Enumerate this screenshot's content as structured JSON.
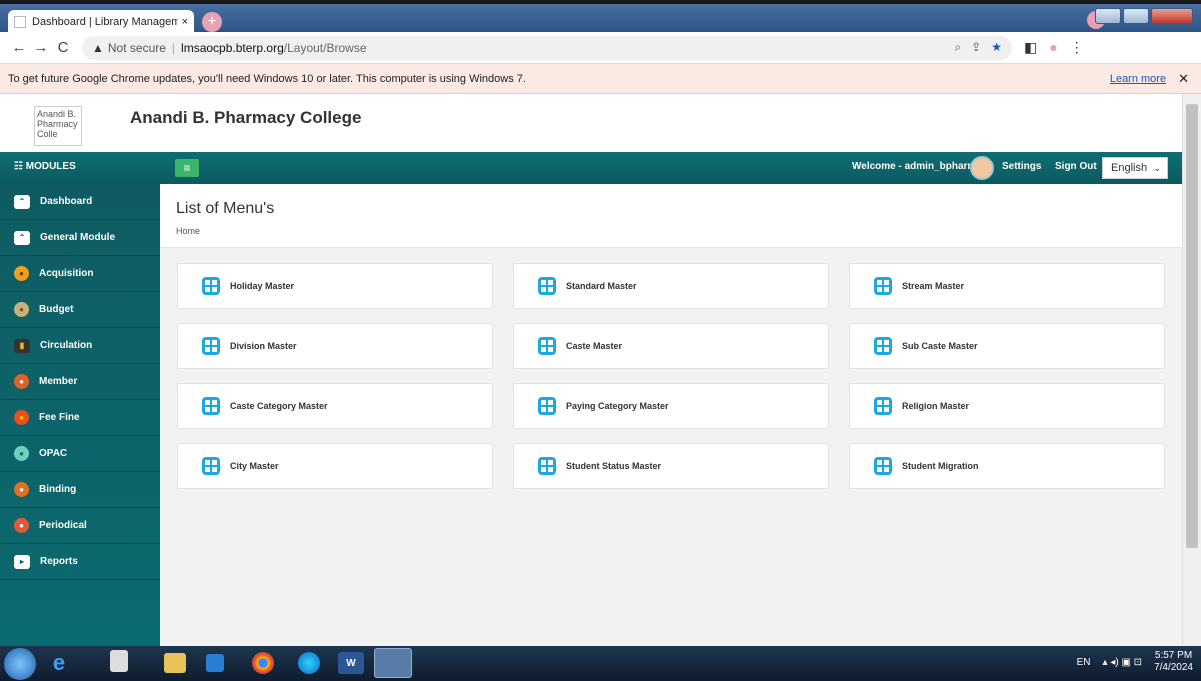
{
  "browser": {
    "tab_title": "Dashboard | Library Managemen",
    "tab_close": "×",
    "new_tab": "+",
    "back": "←",
    "forward": "→",
    "reload": "C",
    "security_warning": "▲",
    "security_text": "Not secure",
    "separator": "|",
    "url_domain": "lmsaocpb.bterp.org",
    "url_path": "/Layout/Browse",
    "zoom_icon": "⌕",
    "share_icon": "⇪",
    "bookmark_icon": "★",
    "sidepanel_icon": "◧",
    "profile_icon": "●",
    "menu_icon": "⋮"
  },
  "infobar": {
    "message": "To get future Google Chrome updates, you'll need Windows 10 or later. This computer is using Windows 7.",
    "learn_more": "Learn more",
    "close": "✕"
  },
  "header": {
    "logo_alt": "Anandi B. Pharmacy Colle",
    "college_name": "Anandi B. Pharmacy College"
  },
  "topnav": {
    "modules_label": "MODULES",
    "modules_icon": "☷",
    "menu_toggle": "≡",
    "welcome": "Welcome - admin_bpharm",
    "settings": "Settings",
    "sign_out": "Sign Out",
    "language": "English",
    "language_chevron": "⌄"
  },
  "sidebar": {
    "items": [
      {
        "label": "Dashboard",
        "icon": "⌃"
      },
      {
        "label": "General Module",
        "icon": "⌃"
      },
      {
        "label": "Acquisition",
        "icon": "●"
      },
      {
        "label": "Budget",
        "icon": "●"
      },
      {
        "label": "Circulation",
        "icon": "▮"
      },
      {
        "label": "Member",
        "icon": "●"
      },
      {
        "label": "Fee Fine",
        "icon": "●"
      },
      {
        "label": "OPAC",
        "icon": "●"
      },
      {
        "label": "Binding",
        "icon": "●"
      },
      {
        "label": "Periodical",
        "icon": "●"
      },
      {
        "label": "Reports",
        "icon": "▸"
      }
    ]
  },
  "main": {
    "title": "List of Menu's",
    "breadcrumb": "Home",
    "cards": [
      "Holiday Master",
      "Standard Master",
      "Stream Master",
      "Division Master",
      "Caste Master",
      "Sub Caste Master",
      "Caste Category Master",
      "Paying Category Master",
      "Religion Master",
      "City Master",
      "Student Status Master",
      "Student Migration"
    ]
  },
  "taskbar": {
    "lang": "EN",
    "tray_icons": "▴ ◂) ▣ ⊡",
    "time": "5:57 PM",
    "date": "7/4/2024"
  },
  "colors": {
    "teal": "#0b6a70",
    "green_toggle": "#3bb56a",
    "win_icon": "#1da7e0"
  }
}
